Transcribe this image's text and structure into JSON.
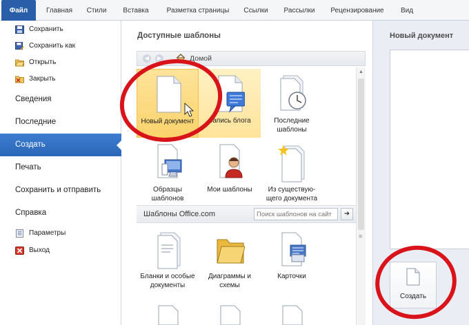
{
  "ribbon": {
    "tabs": [
      "Файл",
      "Главная",
      "Стили",
      "Вставка",
      "Разметка страницы",
      "Ссылки",
      "Рассылки",
      "Рецензирование",
      "Вид"
    ]
  },
  "leftnav": {
    "quick": [
      "Сохранить",
      "Сохранить как",
      "Открыть",
      "Закрыть"
    ],
    "items": [
      "Сведения",
      "Последние",
      "Создать",
      "Печать",
      "Сохранить и отправить",
      "Справка"
    ],
    "bottom": [
      "Параметры",
      "Выход"
    ],
    "selected": "Создать"
  },
  "templates": {
    "title": "Доступные шаблоны",
    "breadcrumb": "Домой",
    "tiles": [
      {
        "label": "Новый документ",
        "icon": "blank-document-icon"
      },
      {
        "label": "Запись блога",
        "icon": "blog-post-icon"
      },
      {
        "label": "Последние шаблоны",
        "icon": "recent-templates-icon"
      },
      {
        "label": "Образцы шаблонов",
        "icon": "sample-templates-icon"
      },
      {
        "label": "Мои шаблоны",
        "icon": "my-templates-icon"
      },
      {
        "label": "Из существую-щего документа",
        "icon": "from-existing-icon"
      }
    ],
    "office_section": "Шаблоны Office.com",
    "search_placeholder": "Поиск шаблонов на сайт",
    "office_tiles": [
      {
        "label": "Бланки и особые документы",
        "icon": "forms-icon"
      },
      {
        "label": "Диаграммы и схемы",
        "icon": "folder-icon"
      },
      {
        "label": "Карточки",
        "icon": "cards-icon"
      }
    ]
  },
  "preview": {
    "title": "Новый документ",
    "create_label": "Создать"
  },
  "colors": {
    "accent": "#2a5ea8",
    "selection": "#fbd36c",
    "annotation": "#d8141a"
  }
}
